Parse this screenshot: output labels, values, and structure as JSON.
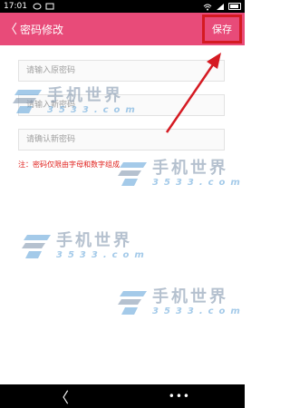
{
  "status_bar": {
    "time": "17:01",
    "icons": [
      "chat-icon",
      "message-icon",
      "wifi-icon",
      "signal-icon",
      "battery-icon"
    ]
  },
  "app_bar": {
    "back_symbol": "〈",
    "title": "密码修改",
    "save_label": "保存",
    "color": "#e84b79",
    "highlight_color": "#d51a22"
  },
  "form": {
    "fields": [
      {
        "placeholder": "请输入原密码",
        "value": ""
      },
      {
        "placeholder": "请输入新密码",
        "value": ""
      },
      {
        "placeholder": "请确认新密码",
        "value": ""
      }
    ],
    "note": "注：密码仅限由字母和数字组成"
  },
  "watermark": {
    "main": "手机世界",
    "sub": "3533.com"
  },
  "nav_bar": {
    "back_symbol": "〈",
    "more_symbol": "•••"
  }
}
